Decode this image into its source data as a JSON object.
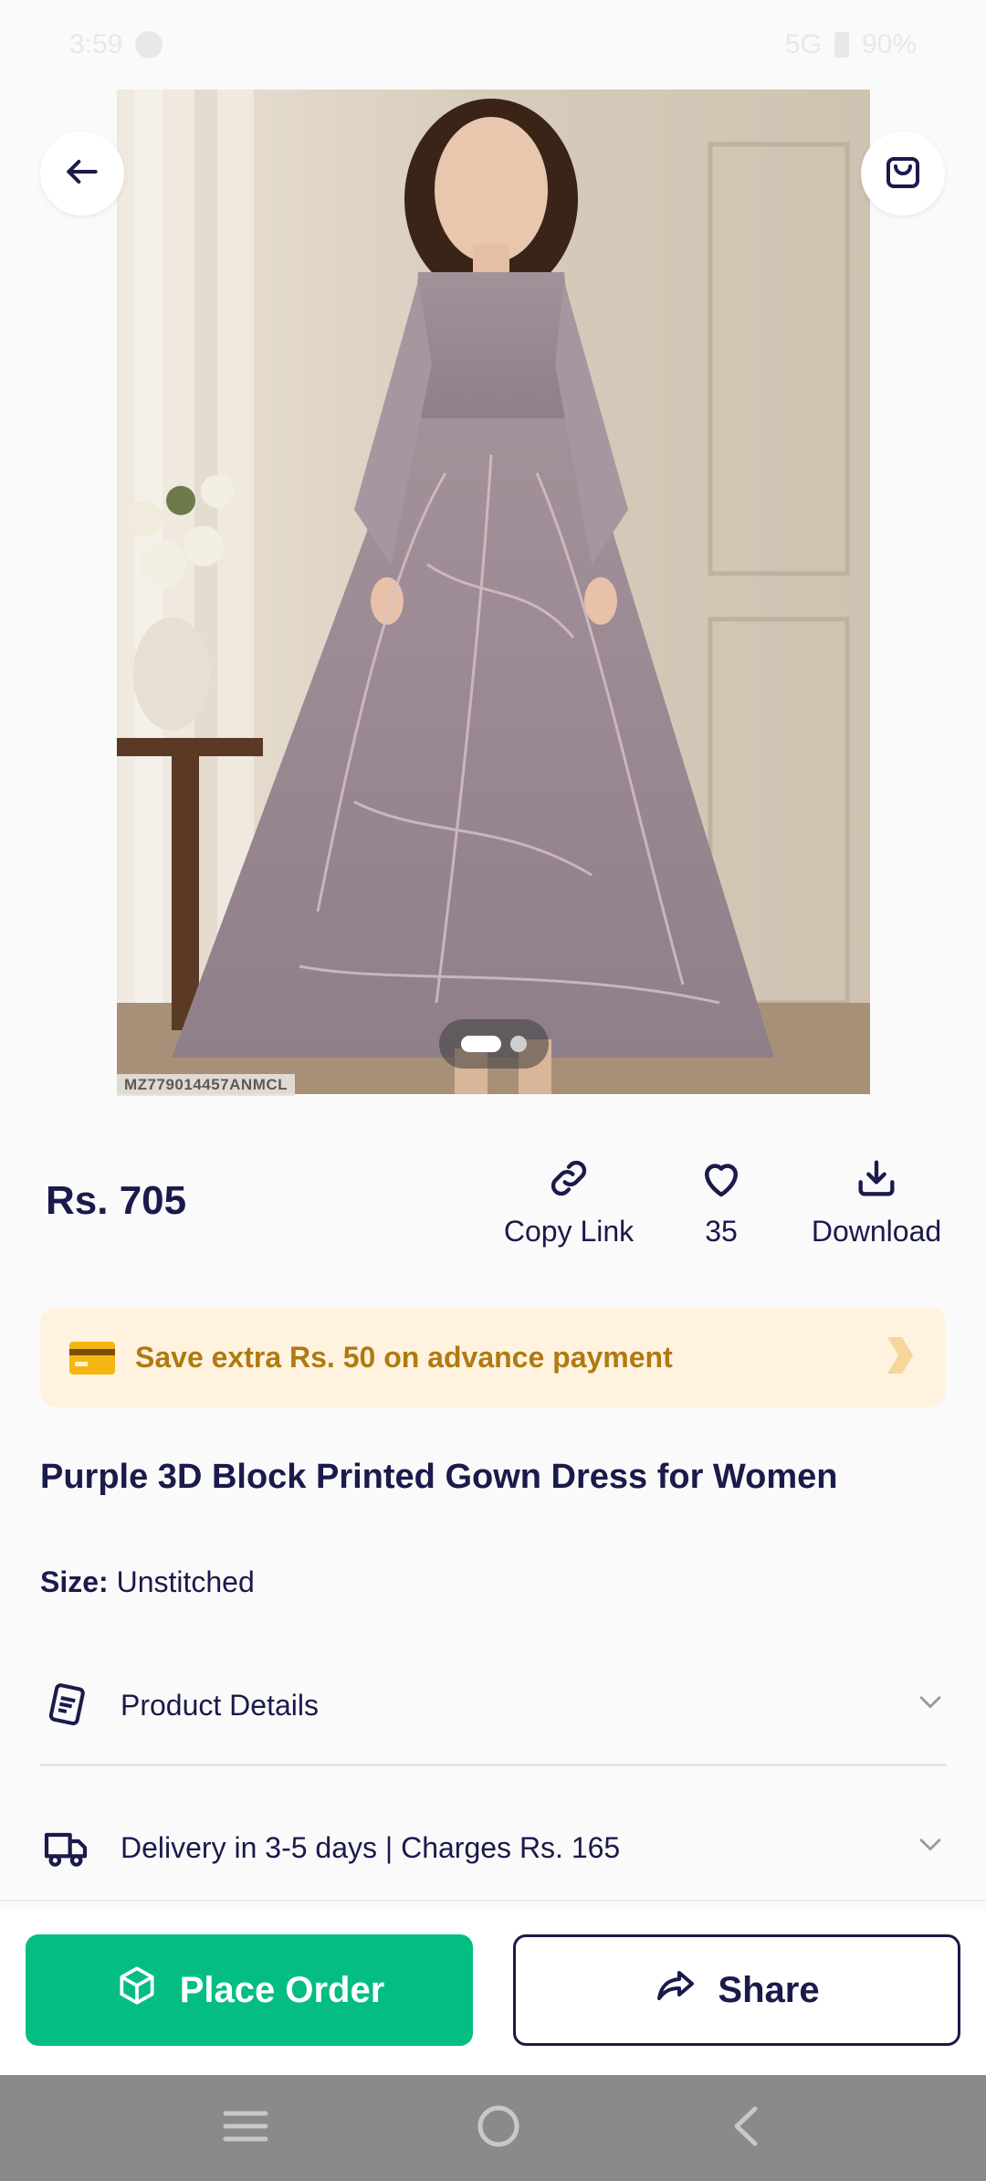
{
  "status_bar": {
    "time": "3:59",
    "network": "5G",
    "battery": "90%"
  },
  "hero": {
    "sku": "MZ779014457ANMCL",
    "image_count": 2,
    "active_image": 1
  },
  "product": {
    "price": "Rs. 705",
    "title": "Purple 3D Block Printed Gown Dress for Women",
    "size_label": "Size:",
    "size_value": "Unstitched"
  },
  "actions": {
    "copy_link": "Copy Link",
    "likes": "35",
    "download": "Download"
  },
  "save_banner": {
    "text": "Save extra Rs. 50 on advance payment"
  },
  "accordion": {
    "product_details": "Product Details",
    "delivery": "Delivery in 3-5 days | Charges Rs. 165"
  },
  "bottom_bar": {
    "place_order": "Place Order",
    "share": "Share"
  },
  "colors": {
    "brand_green": "#04bd83",
    "navy": "#1a1a4b",
    "save_bg": "#fff3df",
    "save_text": "#b07a10"
  },
  "icons": [
    "back-arrow-icon",
    "shopping-bag-icon",
    "link-icon",
    "heart-icon",
    "download-icon",
    "credit-card-icon",
    "chevron-right-icon",
    "document-icon",
    "chevron-down-icon",
    "delivery-truck-icon",
    "box-icon",
    "share-arrow-icon",
    "menu-icon",
    "home-icon",
    "back-icon"
  ]
}
